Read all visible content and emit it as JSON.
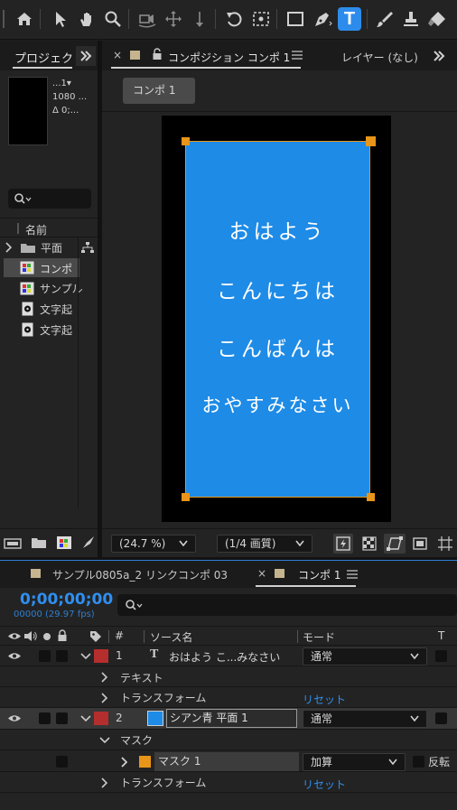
{
  "toolbar": {
    "tools": [
      "home-icon",
      "selection-icon",
      "hand-icon",
      "zoom-icon",
      "orbit-camera-icon",
      "pan-camera-icon",
      "dolly-camera-icon",
      "rotate-icon",
      "anchor-point-icon",
      "rectangle-icon",
      "pen-icon",
      "type-icon",
      "brush-icon",
      "clone-stamp-icon",
      "eraser-icon"
    ],
    "active_tool": "type-icon",
    "active_label": "T"
  },
  "project_panel": {
    "tab_label": "プロジェクト",
    "preview_info": [
      "...1▾",
      "1080 ...",
      "Δ 0;..."
    ],
    "column_name": "名前",
    "items": [
      {
        "label": "平面",
        "type": "folder"
      },
      {
        "label": "コンポ",
        "type": "comp"
      },
      {
        "label": "サンプル",
        "type": "comp"
      },
      {
        "label": "文字起",
        "type": "audio"
      },
      {
        "label": "文字起",
        "type": "audio"
      }
    ]
  },
  "comp_viewer": {
    "tab_label": "コンポジション コンポ 1",
    "layer_tab": "レイヤー (なし)",
    "breadcrumb": "コンポ 1",
    "texts": [
      "おはよう",
      "こんにちは",
      "こんばんは",
      "おやすみなさい"
    ],
    "zoom": "(24.7 %)",
    "quality": "(1/4 画質)",
    "colors": {
      "solid": "#1e8be6",
      "mask_outline": "#e8951a"
    }
  },
  "timeline": {
    "tabs": [
      "サンプル0805a_2 リンクコンポ 03",
      "コンポ 1"
    ],
    "timecode": "0;00;00;00",
    "frame_info": "00000 (29.97 fps)",
    "search_placeholder": "",
    "headers": {
      "hash": "#",
      "source_name": "ソース名",
      "mode": "モード",
      "t": "T"
    },
    "layers": [
      {
        "num": "1",
        "type_glyph": "T",
        "name": "おはよう こ...みなさい",
        "mode": "通常",
        "label_color": "#b52e2e"
      },
      {
        "num": "2",
        "name": "シアン青 平面 1",
        "mode": "通常",
        "label_color": "#b52e2e",
        "swatch": "#1e8be6"
      }
    ],
    "props": {
      "text": "テキスト",
      "transform": "トランスフォーム",
      "reset": "リセット",
      "mask": "マスク",
      "mask1": "マスク 1",
      "mask_mode": "加算",
      "invert": "反転"
    }
  }
}
